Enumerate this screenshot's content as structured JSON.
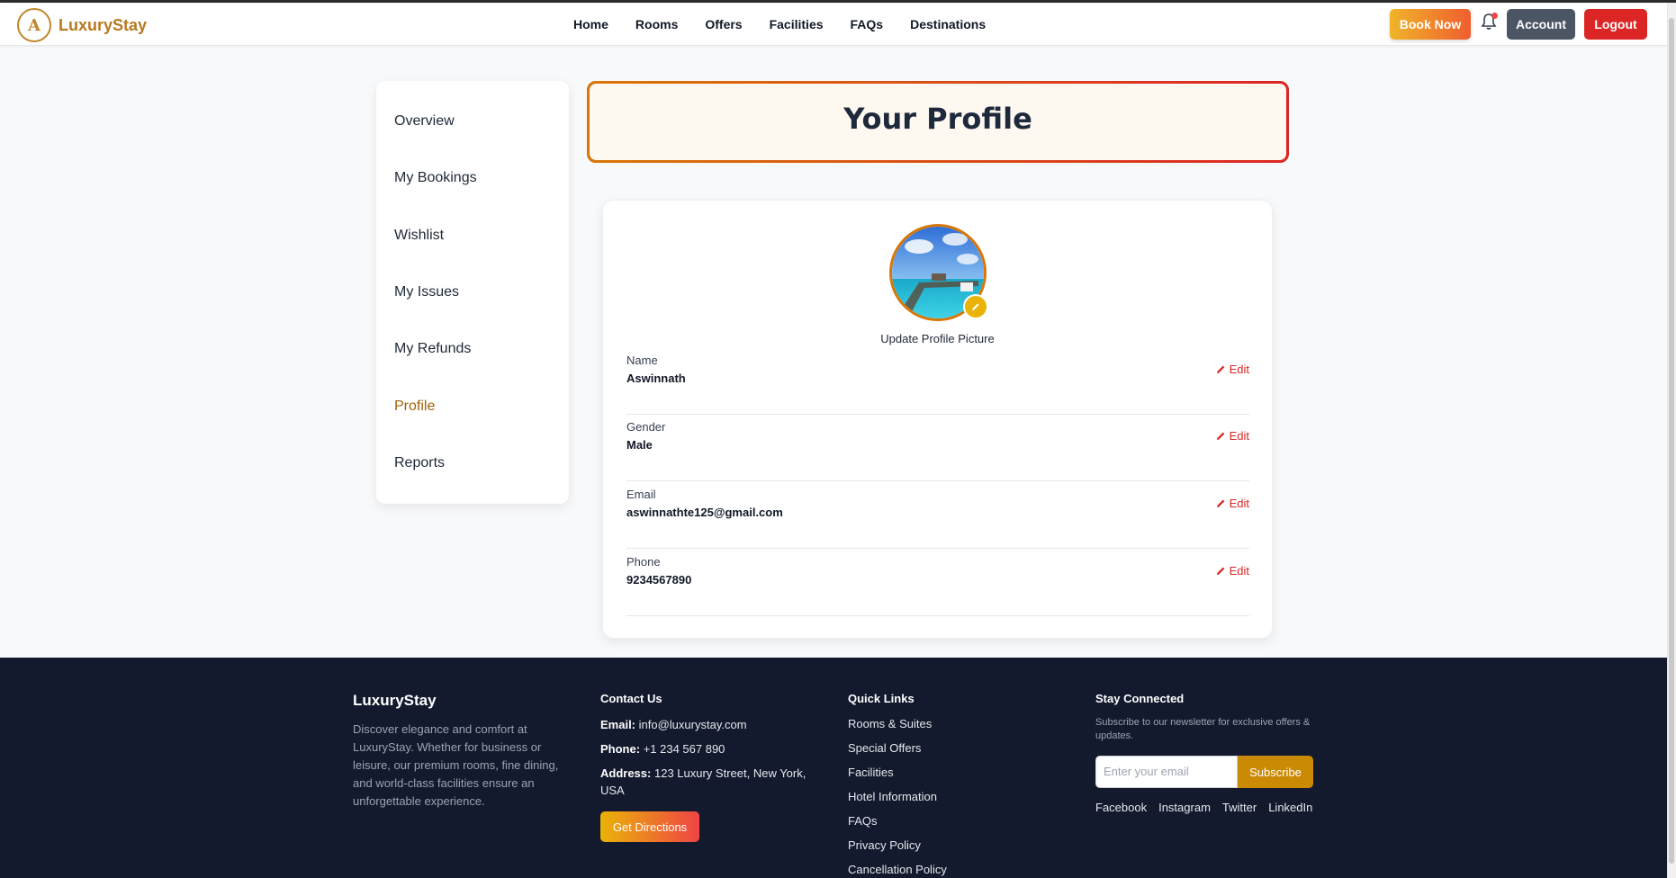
{
  "brand": {
    "logo_letter": "A",
    "name": "LuxuryStay"
  },
  "nav": {
    "links": [
      "Home",
      "Rooms",
      "Offers",
      "Facilities",
      "FAQs",
      "Destinations"
    ],
    "book_now": "Book Now",
    "account": "Account",
    "logout": "Logout"
  },
  "sidebar": {
    "items": [
      "Overview",
      "My Bookings",
      "Wishlist",
      "My Issues",
      "My Refunds",
      "Profile",
      "Reports"
    ],
    "active": "Profile"
  },
  "profile": {
    "title": "Your Profile",
    "update_picture": "Update Profile Picture",
    "edit_label": "Edit",
    "fields": [
      {
        "label": "Name",
        "value": "Aswinnath"
      },
      {
        "label": "Gender",
        "value": "Male"
      },
      {
        "label": "Email",
        "value": "aswinnathte125@gmail.com"
      },
      {
        "label": "Phone",
        "value": "9234567890"
      }
    ]
  },
  "footer": {
    "brand": "LuxuryStay",
    "description": "Discover elegance and comfort at LuxuryStay. Whether for business or leisure, our premium rooms, fine dining, and world-class facilities ensure an unforgettable experience.",
    "contact": {
      "heading": "Contact Us",
      "email_label": "Email:",
      "email": "info@luxurystay.com",
      "phone_label": "Phone:",
      "phone": "+1 234 567 890",
      "address_label": "Address:",
      "address": "123 Luxury Street, New York, USA",
      "directions": "Get Directions"
    },
    "quick_links": {
      "heading": "Quick Links",
      "items": [
        "Rooms & Suites",
        "Special Offers",
        "Facilities",
        "Hotel Information",
        "FAQs",
        "Privacy Policy",
        "Cancellation Policy"
      ]
    },
    "newsletter": {
      "heading": "Stay Connected",
      "text": "Subscribe to our newsletter for exclusive offers & updates.",
      "placeholder": "Enter your email",
      "subscribe": "Subscribe",
      "social": [
        "Facebook",
        "Instagram",
        "Twitter",
        "LinkedIn"
      ]
    }
  },
  "colors": {
    "accent": "#b7791f",
    "danger": "#dc2626",
    "footer_bg": "#131a2e"
  }
}
